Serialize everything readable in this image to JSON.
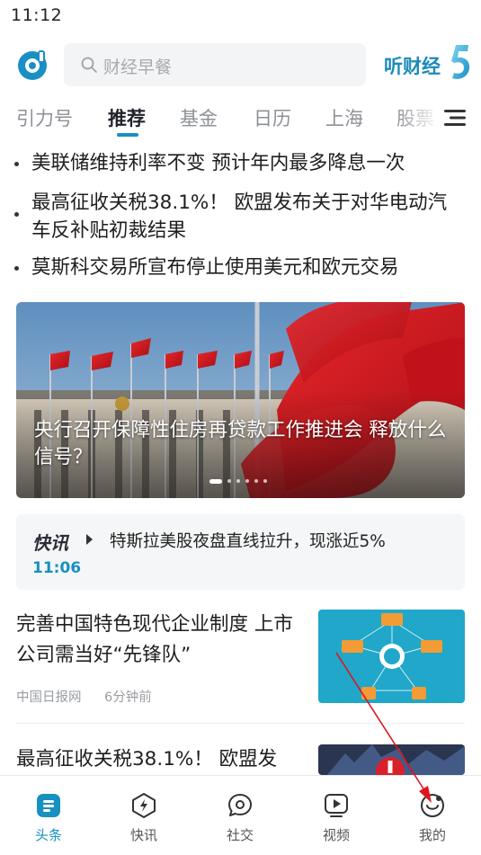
{
  "status_bar": {
    "time": "11:12"
  },
  "header": {
    "logo_icon": "app-logo-icon",
    "search_placeholder": "财经早餐",
    "listen_label": "听财经"
  },
  "tabs": {
    "items": [
      {
        "label": "引力号"
      },
      {
        "label": "推荐"
      },
      {
        "label": "基金"
      },
      {
        "label": "日历"
      },
      {
        "label": "上海"
      },
      {
        "label": "股票"
      }
    ],
    "active": "推荐",
    "accent": "#1890c0"
  },
  "headlines": [
    {
      "text": "美联储维持利率不变 预计年内最多降息一次"
    },
    {
      "text": "最高征收关税38.1%！ 欧盟发布关于对华电动汽车反补贴初裁结果"
    },
    {
      "text": "莫斯科交易所宣布停止使用美元和欧元交易"
    }
  ],
  "banner": {
    "title": "央行召开保障性住房再贷款工作推进会 释放什么信号？",
    "page_count": 6,
    "active_page": 0
  },
  "flash": {
    "label": "快讯",
    "text": "特斯拉美股夜盘直线拉升，现涨近5%",
    "time": "11:06"
  },
  "articles": [
    {
      "title": "完善中国特色现代企业制度 上市公司需当好“先锋队”",
      "source": "中国日报网",
      "time": "6分钟前"
    },
    {
      "title": "最高征收关税38.1%！ 欧盟发"
    }
  ],
  "bottom_nav": {
    "items": [
      {
        "label": "头条",
        "icon": "headlines-icon"
      },
      {
        "label": "快讯",
        "icon": "flash-icon"
      },
      {
        "label": "社交",
        "icon": "social-icon"
      },
      {
        "label": "视频",
        "icon": "video-icon"
      },
      {
        "label": "我的",
        "icon": "profile-icon"
      }
    ],
    "active": "头条"
  }
}
